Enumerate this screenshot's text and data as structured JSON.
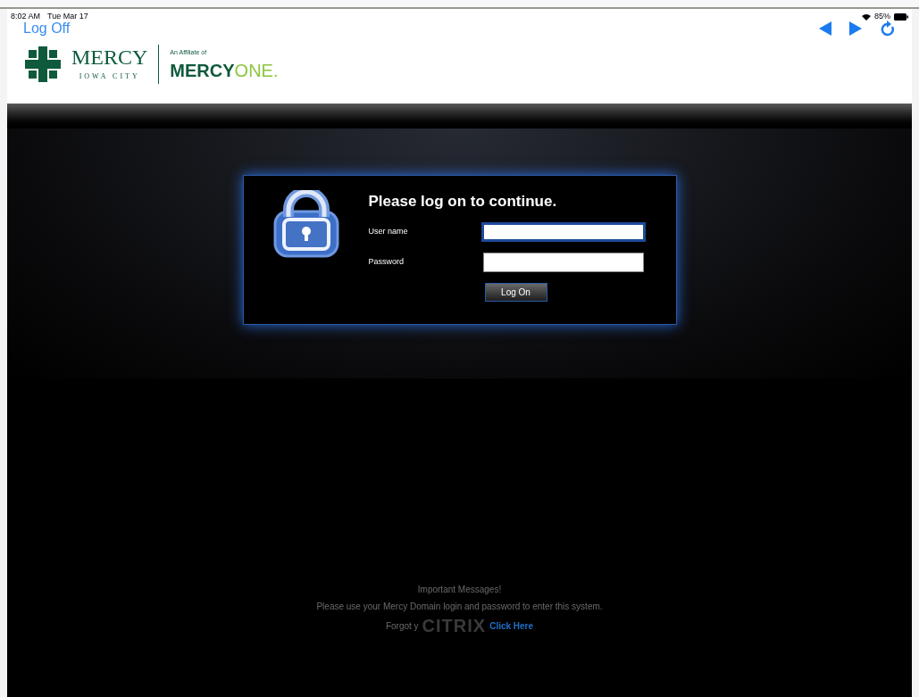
{
  "status_bar": {
    "time": "8:02 AM",
    "date": "Tue Mar 17",
    "battery": "85%"
  },
  "toolbar": {
    "log_off": "Log Off"
  },
  "logo": {
    "name": "MERCY",
    "place": "IOWA CITY",
    "affiliate": "An Affiliate of",
    "wordmark_main": "MERCY",
    "wordmark_accent": "ONE."
  },
  "login": {
    "title": "Please log on to continue.",
    "fields": [
      {
        "label": "User name",
        "focused": true
      },
      {
        "label": "Password",
        "focused": false
      }
    ],
    "button": "Log On"
  },
  "messages": {
    "heading": "Important Messages!",
    "body": "Please use your Mercy Domain login and password to enter this system.",
    "forgot": "Forgot y",
    "link": "Click Here",
    "brand": "CITRIX"
  }
}
